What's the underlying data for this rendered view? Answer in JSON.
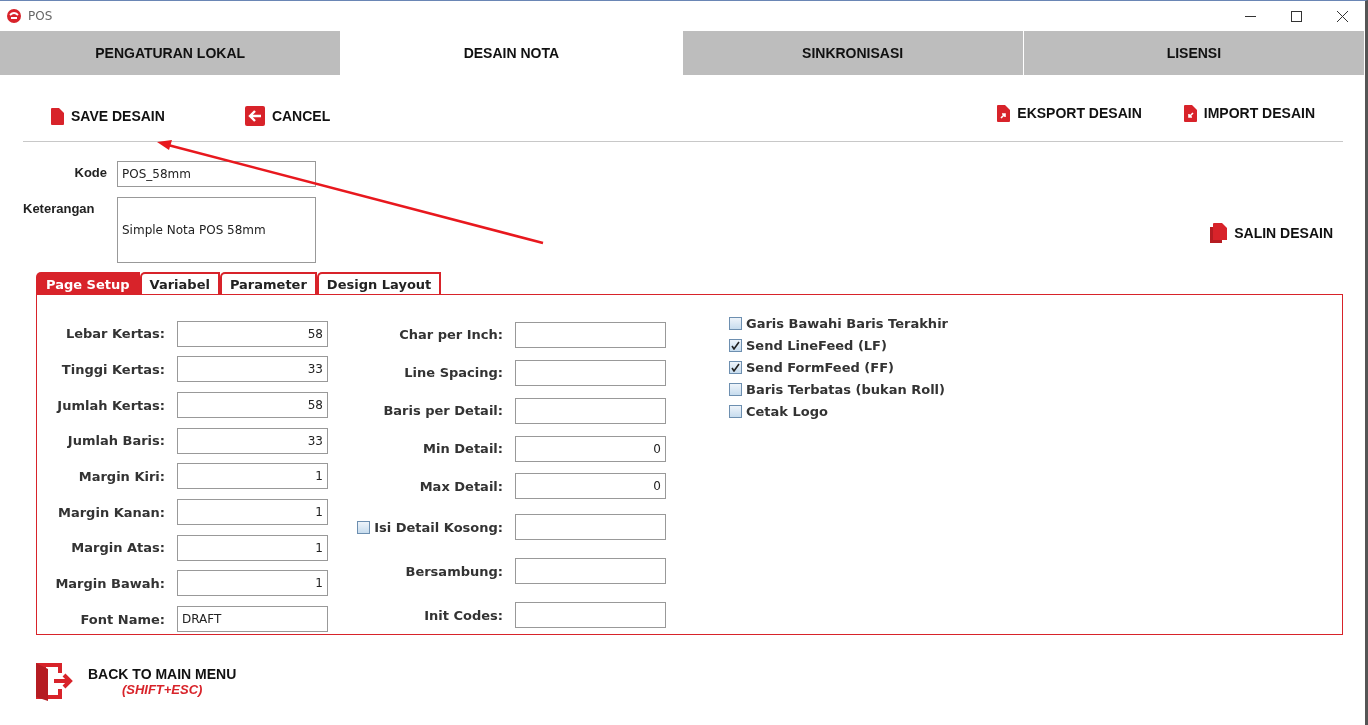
{
  "window": {
    "title": "POS"
  },
  "main_tabs": [
    {
      "label": "PENGATURAN LOKAL",
      "selected": false
    },
    {
      "label": "DESAIN NOTA",
      "selected": true
    },
    {
      "label": "SINKRONISASI",
      "selected": false
    },
    {
      "label": "LISENSI",
      "selected": false
    }
  ],
  "toolbar_left": [
    {
      "label": "SAVE DESAIN",
      "kind": "save"
    },
    {
      "label": "CANCEL",
      "kind": "cancel"
    }
  ],
  "toolbar_right": [
    {
      "label": "EKSPORT DESAIN",
      "kind": "export"
    },
    {
      "label": "IMPORT DESAIN",
      "kind": "import"
    }
  ],
  "kode": {
    "label": "Kode",
    "value": "POS_58mm"
  },
  "keterangan": {
    "label": "Keterangan",
    "value": "Simple Nota POS 58mm"
  },
  "salin_button": {
    "label": "SALIN DESAIN"
  },
  "sub_tabs": [
    {
      "label": "Page Setup",
      "selected": true
    },
    {
      "label": "Variabel",
      "selected": false
    },
    {
      "label": "Parameter",
      "selected": false
    },
    {
      "label": "Design Layout",
      "selected": false
    }
  ],
  "page_setup_fields": [
    {
      "kind": "number",
      "label": "Lebar Kertas:",
      "value": "58"
    },
    {
      "kind": "number",
      "label": "Tinggi Kertas:",
      "value": "33"
    },
    {
      "kind": "number",
      "label": "Jumlah Kertas:",
      "value": "58"
    },
    {
      "kind": "number",
      "label": "Jumlah Baris:",
      "value": "33"
    },
    {
      "kind": "number",
      "label": "Margin Kiri:",
      "value": "1"
    },
    {
      "kind": "number",
      "label": "Margin Kanan:",
      "value": "1"
    },
    {
      "kind": "number",
      "label": "Margin Atas:",
      "value": "1"
    },
    {
      "kind": "number",
      "label": "Margin Bawah:",
      "value": "1"
    },
    {
      "kind": "text",
      "label": "Font Name:",
      "value": "DRAFT"
    }
  ],
  "detail_fields": [
    {
      "kind": "text",
      "label": "Char per Inch:"
    },
    {
      "kind": "text",
      "label": "Line Spacing:"
    },
    {
      "kind": "text",
      "label": "Baris per Detail:"
    },
    {
      "kind": "text",
      "label": "Min Detail:",
      "value": "0"
    },
    {
      "kind": "text",
      "label": "Max Detail:",
      "value": "0"
    },
    {
      "kind": "check",
      "label": "Isi Detail Kosong:",
      "checked": false
    },
    {
      "kind": "text",
      "label": "Bersambung:"
    },
    {
      "kind": "text",
      "label": "Init Codes:"
    }
  ],
  "options": [
    {
      "label": "Garis Bawahi Baris Terakhir",
      "checked": false
    },
    {
      "label": "Send LineFeed (LF)",
      "checked": true
    },
    {
      "label": "Send FormFeed (FF)",
      "checked": true
    },
    {
      "label": "Baris Terbatas (bukan Roll)",
      "checked": false
    },
    {
      "label": "Cetak Logo",
      "checked": false
    }
  ],
  "back_button": {
    "label": "BACK TO MAIN MENU",
    "shortcut": "(SHIFT+ESC)"
  }
}
